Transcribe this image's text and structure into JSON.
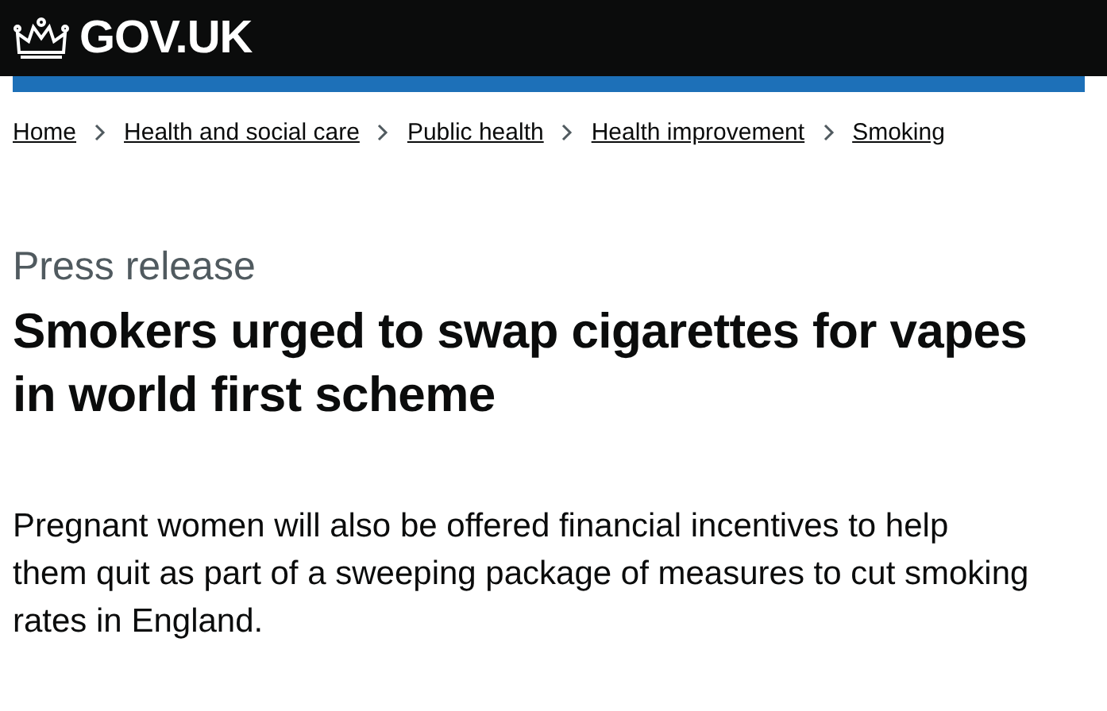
{
  "header": {
    "logo_text": "GOV.UK"
  },
  "breadcrumbs": [
    "Home",
    "Health and social care",
    "Public health",
    "Health improvement",
    "Smoking"
  ],
  "caption": "Press release",
  "title": "Smokers urged to swap cigarettes for vapes in world first scheme",
  "lead": "Pregnant women will also be offered financial incentives to help them quit as part of a sweeping package of measures to cut smoking rates in England."
}
